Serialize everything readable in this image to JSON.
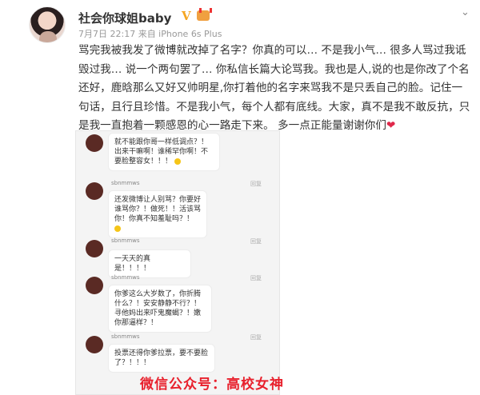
{
  "post": {
    "username": "社会你球姐baby",
    "verified_badge": "V",
    "meta": "7月7日 22:17 来自 iPhone 6s Plus",
    "body": "骂完我被我发了微博就改掉了名字？你真的可以… 不是我小气… 很多人骂过我诋毁过我… 说一个两句罢了… 你私信长篇大论骂我。我也是人,说的也是你改了个名还好，鹿晗那么又好又帅明星,你打着他的名字来骂我不是只丢自己的脸。记住一句话，且行且珍惜。不是我小气，每个人都有底线。大家，真不是我不敢反抗，只是我一直抱着一颗感恩的心一路走下来。 多一点正能量谢谢你们",
    "heart": "❤",
    "more_icon": "chevron-down-icon"
  },
  "embedded": {
    "comments": [
      {
        "name": "",
        "text": "就不能跟你哥一样低调点？！出来干嘛啊！谁稀罕你啊！不要脸整容女！！！",
        "reply": ""
      },
      {
        "name": "sbnmmws",
        "text": "还发微博让人别骂？你要好谁骂你？！做死！！活该骂你！你真不知羞耻吗？！",
        "reply": "回复"
      },
      {
        "name": "sbnmmws",
        "text": "一天天的真是！！！！",
        "reply": "回复"
      },
      {
        "name": "sbnmmws",
        "text": "你爹这么大岁数了，你折腾什么？！安安静静不行？！寻他妈出来吓鬼魔蝎？！嫩你那逼样？！",
        "reply": "回复"
      },
      {
        "name": "sbnmmws",
        "text": "投票还得你爹拉票，要不要脸了？！！！",
        "reply": "回复"
      }
    ]
  },
  "watermark": "微信公众号：高校女神"
}
